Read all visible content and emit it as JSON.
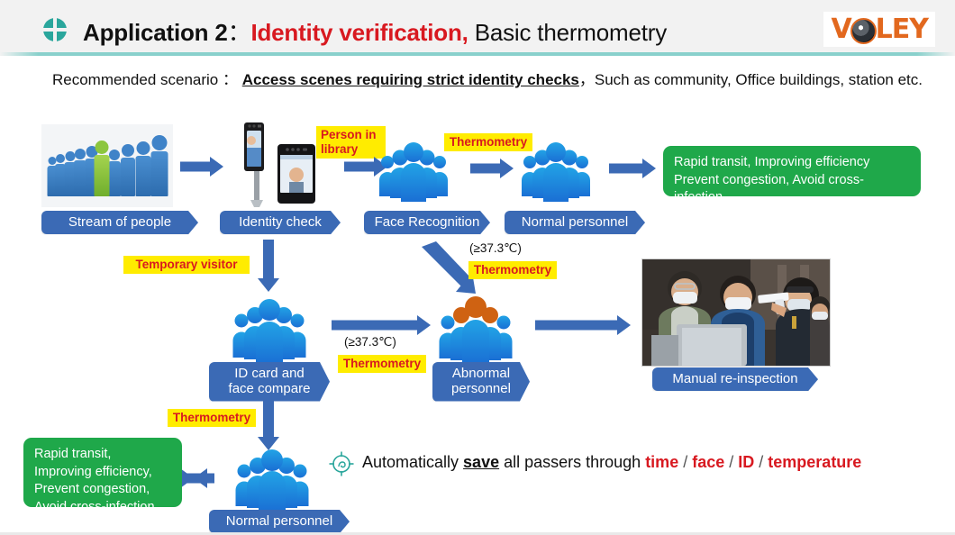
{
  "header": {
    "bullet_icon": "circle-cross-icon",
    "title_main": "Application 2",
    "title_colon": "：",
    "title_red": "Identity verification,",
    "title_rest": " Basic thermometry",
    "logo_before": "V",
    "logo_lens_icon": "camera-lens-icon",
    "logo_after": "LEY"
  },
  "subtitle": {
    "label": "Recommended scenario ：",
    "emphasis": "Access scenes requiring strict identity checks",
    "rest": "，Such as community, Office buildings, station etc."
  },
  "flow": {
    "stream_of_people": "Stream of people",
    "identity_check": "Identity check",
    "face_recognition": "Face Recognition",
    "normal_personnel_top": "Normal personnel",
    "id_card_and_face_compare": "ID card and\nface compare",
    "abnormal_personnel": "Abnormal\npersonnel",
    "manual_reinspection": "Manual re-inspection",
    "normal_personnel_bottom": "Normal personnel"
  },
  "highlights": {
    "person_in_library": "Person in\nlibrary",
    "thermometry_1": "Thermometry",
    "temporary_visitor": "Temporary visitor",
    "thermometry_2": "Thermometry",
    "thermometry_3": "Thermometry",
    "thermometry_4": "Thermometry"
  },
  "temp_notes": {
    "note_upper": "(≥37.3℃)",
    "note_lower": "(≥37.3℃)"
  },
  "green_boxes": {
    "top_right_line1": "Rapid transit, Improving efficiency",
    "top_right_line2": "Prevent congestion, Avoid cross-infection",
    "bottom_left_line1": "Rapid transit,",
    "bottom_left_line2": "Improving efficiency,",
    "bottom_left_line3": "Prevent congestion,",
    "bottom_left_line4": "Avoid cross-infection."
  },
  "footer": {
    "scope_icon": "target-scope-icon",
    "text_1": "Automatically ",
    "save": "save",
    "text_2": " all passers through ",
    "time": "time",
    "sep1": " / ",
    "face": "face",
    "sep2": " / ",
    "id": "ID",
    "sep3": " / ",
    "temperature": "temperature"
  },
  "colors": {
    "teal": "#33b5ac",
    "blue": "#3b6ab5",
    "green": "#1fa84a",
    "red": "#d81920",
    "yellow": "#ffec00",
    "orange": "#e2681e",
    "people_blue_top": "#1f9ae0",
    "people_blue_bottom": "#1f6fd0",
    "people_orange": "#cf6212"
  }
}
